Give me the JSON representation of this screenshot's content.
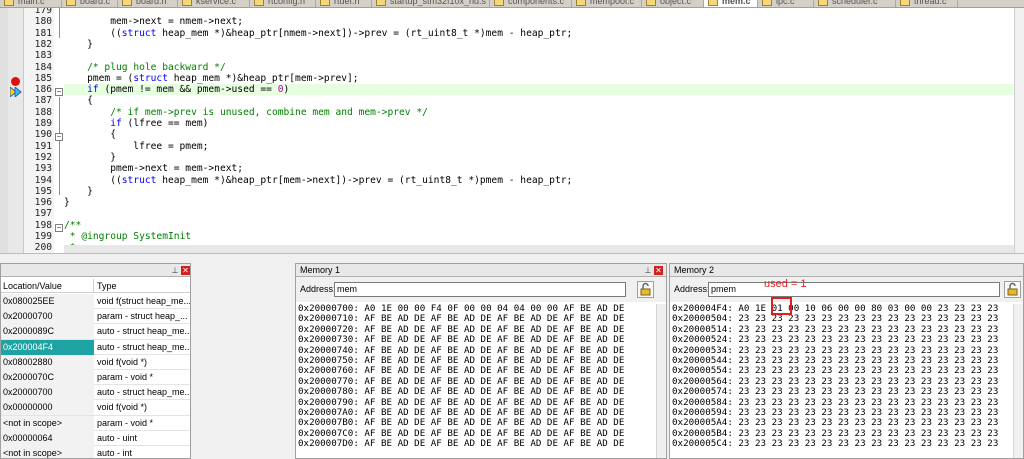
{
  "tabs": [
    {
      "label": "main.c",
      "active": false
    },
    {
      "label": "board.c",
      "active": false
    },
    {
      "label": "board.h",
      "active": false
    },
    {
      "label": "kservice.c",
      "active": false
    },
    {
      "label": "rtconfig.h",
      "active": false
    },
    {
      "label": "rtdef.h",
      "active": false
    },
    {
      "label": "startup_stm32f10x_hd.s",
      "active": false
    },
    {
      "label": "components.c",
      "active": false
    },
    {
      "label": "mempool.c",
      "active": false
    },
    {
      "label": "object.c",
      "active": false
    },
    {
      "label": "mem.c",
      "active": true
    },
    {
      "label": "ipc.c",
      "active": false
    },
    {
      "label": "scheduler.c",
      "active": false
    },
    {
      "label": "thread.c",
      "active": false
    }
  ],
  "editor": {
    "lines": [
      {
        "no": "179",
        "segments": [
          {
            "t": "            "
          }
        ]
      },
      {
        "no": "180",
        "segments": [
          {
            "t": "        mem->next = nmem->next;"
          }
        ]
      },
      {
        "no": "181",
        "segments": [
          {
            "t": "        (("
          },
          {
            "t": "struct",
            "c": "kw"
          },
          {
            "t": " heap_mem *)&heap_ptr[nmem->next])->prev = (rt_uint8_t *)mem - heap_ptr;"
          }
        ]
      },
      {
        "no": "182",
        "segments": [
          {
            "t": "    }"
          }
        ]
      },
      {
        "no": "183",
        "segments": [
          {
            "t": ""
          }
        ]
      },
      {
        "no": "184",
        "segments": [
          {
            "t": "    "
          },
          {
            "t": "/* plug hole backward */",
            "c": "cm"
          }
        ]
      },
      {
        "no": "185",
        "segments": [
          {
            "t": "    pmem = ("
          },
          {
            "t": "struct",
            "c": "kw"
          },
          {
            "t": " heap_mem *)&heap_ptr[mem->prev];"
          }
        ]
      },
      {
        "no": "186",
        "segments": [
          {
            "t": "    "
          },
          {
            "t": "if",
            "c": "kw"
          },
          {
            "t": " (pmem != mem && pmem->used == "
          },
          {
            "t": "0",
            "c": "num"
          },
          {
            "t": ")"
          }
        ]
      },
      {
        "no": "187",
        "segments": [
          {
            "t": "    {"
          }
        ]
      },
      {
        "no": "188",
        "segments": [
          {
            "t": "        "
          },
          {
            "t": "/* if mem->prev is unused, combine mem and mem->prev */",
            "c": "cm"
          }
        ]
      },
      {
        "no": "189",
        "segments": [
          {
            "t": "        "
          },
          {
            "t": "if",
            "c": "kw"
          },
          {
            "t": " (lfree == mem)"
          }
        ]
      },
      {
        "no": "190",
        "segments": [
          {
            "t": "        {"
          }
        ]
      },
      {
        "no": "191",
        "segments": [
          {
            "t": "            lfree = pmem;"
          }
        ]
      },
      {
        "no": "192",
        "segments": [
          {
            "t": "        }"
          }
        ]
      },
      {
        "no": "193",
        "segments": [
          {
            "t": "        pmem->next = mem->next;"
          }
        ]
      },
      {
        "no": "194",
        "segments": [
          {
            "t": "        (("
          },
          {
            "t": "struct",
            "c": "kw"
          },
          {
            "t": " heap_mem *)&heap_ptr[mem->next])->prev = (rt_uint8_t *)pmem - heap_ptr;"
          }
        ]
      },
      {
        "no": "195",
        "segments": [
          {
            "t": "    }"
          }
        ]
      },
      {
        "no": "196",
        "segments": [
          {
            "t": "}"
          }
        ]
      },
      {
        "no": "197",
        "segments": [
          {
            "t": ""
          }
        ]
      },
      {
        "no": "198",
        "segments": [
          {
            "t": "/**",
            "c": "cm"
          }
        ]
      },
      {
        "no": "199",
        "segments": [
          {
            "t": " * @ingroup SystemInit",
            "c": "cm"
          }
        ]
      },
      {
        "no": "200",
        "segments": [
          {
            "t": " *",
            "c": "cm"
          }
        ]
      }
    ]
  },
  "callstack": {
    "col_location": "Location/Value",
    "col_type": "Type",
    "rows": [
      {
        "loc": "0x080025EE",
        "type": "void f(struct heap_me..."
      },
      {
        "loc": "0x20000700",
        "type": "param - struct heap_..."
      },
      {
        "loc": "0x2000089C",
        "type": "auto - struct heap_me..."
      },
      {
        "loc": "0x200004F4",
        "type": "auto - struct heap_me..."
      },
      {
        "loc": "0x08002880",
        "type": "void f(void *)"
      },
      {
        "loc": "0x2000070C",
        "type": "param - void *"
      },
      {
        "loc": "0x20000700",
        "type": "auto - struct heap_me..."
      },
      {
        "loc": "0x00000000",
        "type": "void f(void *)"
      },
      {
        "loc": "<not in scope>",
        "type": "param - void *"
      },
      {
        "loc": "0x00000064",
        "type": "auto - uint"
      },
      {
        "loc": "<not in scope>",
        "type": "auto - int"
      }
    ]
  },
  "memory1": {
    "title": "Memory 1",
    "address_label": "Address:",
    "address_value": "mem",
    "rows": [
      "0x20000700: A0 1E 00 00 F4 0F 00 00 04 04 00 00 AF BE AD DE",
      "0x20000710: AF BE AD DE AF BE AD DE AF BE AD DE AF BE AD DE",
      "0x20000720: AF BE AD DE AF BE AD DE AF BE AD DE AF BE AD DE",
      "0x20000730: AF BE AD DE AF BE AD DE AF BE AD DE AF BE AD DE",
      "0x20000740: AF BE AD DE AF BE AD DE AF BE AD DE AF BE AD DE",
      "0x20000750: AF BE AD DE AF BE AD DE AF BE AD DE AF BE AD DE",
      "0x20000760: AF BE AD DE AF BE AD DE AF BE AD DE AF BE AD DE",
      "0x20000770: AF BE AD DE AF BE AD DE AF BE AD DE AF BE AD DE",
      "0x20000780: AF BE AD DE AF BE AD DE AF BE AD DE AF BE AD DE",
      "0x20000790: AF BE AD DE AF BE AD DE AF BE AD DE AF BE AD DE",
      "0x200007A0: AF BE AD DE AF BE AD DE AF BE AD DE AF BE AD DE",
      "0x200007B0: AF BE AD DE AF BE AD DE AF BE AD DE AF BE AD DE",
      "0x200007C0: AF BE AD DE AF BE AD DE AF BE AD DE AF BE AD DE",
      "0x200007D0: AF BE AD DE AF BE AD DE AF BE AD DE AF BE AD DE"
    ]
  },
  "memory2": {
    "title": "Memory 2",
    "address_label": "Address:",
    "address_value": "pmem",
    "rows": [
      "0x200004F4: A0 1E 01 00 10 06 00 00 80 03 00 00 23 23 23 23",
      "0x20000504: 23 23 23 23 23 23 23 23 23 23 23 23 23 23 23 23",
      "0x20000514: 23 23 23 23 23 23 23 23 23 23 23 23 23 23 23 23",
      "0x20000524: 23 23 23 23 23 23 23 23 23 23 23 23 23 23 23 23",
      "0x20000534: 23 23 23 23 23 23 23 23 23 23 23 23 23 23 23 23",
      "0x20000544: 23 23 23 23 23 23 23 23 23 23 23 23 23 23 23 23",
      "0x20000554: 23 23 23 23 23 23 23 23 23 23 23 23 23 23 23 23",
      "0x20000564: 23 23 23 23 23 23 23 23 23 23 23 23 23 23 23 23",
      "0x20000574: 23 23 23 23 23 23 23 23 23 23 23 23 23 23 23 23",
      "0x20000584: 23 23 23 23 23 23 23 23 23 23 23 23 23 23 23 23",
      "0x20000594: 23 23 23 23 23 23 23 23 23 23 23 23 23 23 23 23",
      "0x200005A4: 23 23 23 23 23 23 23 23 23 23 23 23 23 23 23 23",
      "0x200005B4: 23 23 23 23 23 23 23 23 23 23 23 23 23 23 23 23",
      "0x200005C4: 23 23 23 23 23 23 23 23 23 23 23 23 23 23 23 23"
    ]
  },
  "annotation": {
    "text": "used = 1",
    "color": "#e02020"
  },
  "colors": {
    "selection": "#1ea3a3",
    "current_line": "#e6ffe0",
    "breakpoint": "#e01010"
  }
}
